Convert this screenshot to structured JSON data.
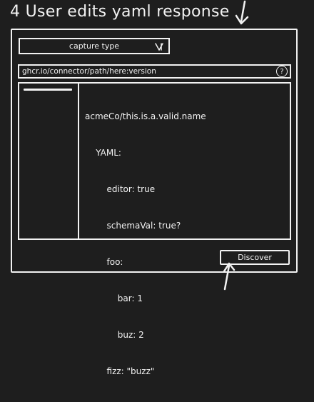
{
  "title": "4 User edits yaml response",
  "capture_select": {
    "value": "capture type",
    "icon": "chevron-down-icon"
  },
  "url_bar": {
    "value": "ghcr.io/connector/path/here:version",
    "help_label": "?"
  },
  "yaml_editor": {
    "lines": [
      "acmeCo/this.is.a.valid.name",
      "    YAML:",
      "        editor: true",
      "        schemaVal: true?",
      "        foo:",
      "            bar: 1",
      "            buz: 2",
      "        fizz: \"buzz\""
    ]
  },
  "discover_button": {
    "label": "Discover"
  }
}
